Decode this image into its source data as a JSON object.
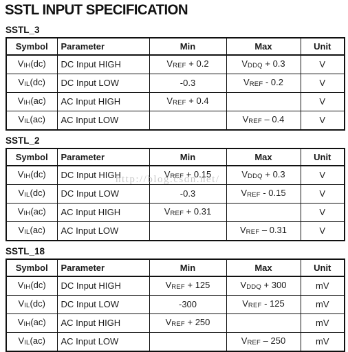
{
  "document": {
    "title": "SSTL INPUT SPECIFICATION",
    "watermark": "http://blog.csdn.net/"
  },
  "columns": {
    "symbol": "Symbol",
    "parameter": "Parameter",
    "min": "Min",
    "max": "Max",
    "unit": "Unit"
  },
  "sections": [
    {
      "label": "SSTL_3",
      "rows": [
        {
          "symbol_prefix": "V",
          "symbol_sub": "IH",
          "symbol_suffix": "(dc)",
          "parameter": "DC Input HIGH",
          "min_prefix": "V",
          "min_sub": "REF",
          "min_suffix": " + 0.2",
          "max_prefix": "V",
          "max_sub": "DDQ",
          "max_suffix": " + 0.3",
          "unit": "V"
        },
        {
          "symbol_prefix": "V",
          "symbol_sub": "IL",
          "symbol_suffix": "(dc)",
          "parameter": "DC Input LOW",
          "min_prefix": "-0.3",
          "min_sub": "",
          "min_suffix": "",
          "max_prefix": "V",
          "max_sub": "REF",
          "max_suffix": " - 0.2",
          "unit": "V"
        },
        {
          "symbol_prefix": "V",
          "symbol_sub": "IH",
          "symbol_suffix": "(ac)",
          "parameter": "AC Input HIGH",
          "min_prefix": "V",
          "min_sub": "REF",
          "min_suffix": " + 0.4",
          "max_prefix": "",
          "max_sub": "",
          "max_suffix": "",
          "unit": "V"
        },
        {
          "symbol_prefix": "V",
          "symbol_sub": "IL",
          "symbol_suffix": "(ac)",
          "parameter": "AC Input LOW",
          "min_prefix": "",
          "min_sub": "",
          "min_suffix": "",
          "max_prefix": "V",
          "max_sub": "REF",
          "max_suffix": " – 0.4",
          "unit": "V"
        }
      ]
    },
    {
      "label": "SSTL_2",
      "rows": [
        {
          "symbol_prefix": "V",
          "symbol_sub": "IH",
          "symbol_suffix": "(dc)",
          "parameter": "DC Input HIGH",
          "min_prefix": "V",
          "min_sub": "REF",
          "min_suffix": " + 0.15",
          "max_prefix": "V",
          "max_sub": "DDQ",
          "max_suffix": " + 0.3",
          "unit": "V"
        },
        {
          "symbol_prefix": "V",
          "symbol_sub": "IL",
          "symbol_suffix": "(dc)",
          "parameter": "DC Input LOW",
          "min_prefix": "-0.3",
          "min_sub": "",
          "min_suffix": "",
          "max_prefix": "V",
          "max_sub": "REF",
          "max_suffix": " - 0.15",
          "unit": "V"
        },
        {
          "symbol_prefix": "V",
          "symbol_sub": "IH",
          "symbol_suffix": "(ac)",
          "parameter": "AC Input HIGH",
          "min_prefix": "V",
          "min_sub": "REF",
          "min_suffix": " + 0.31",
          "max_prefix": "",
          "max_sub": "",
          "max_suffix": "",
          "unit": "V"
        },
        {
          "symbol_prefix": "V",
          "symbol_sub": "IL",
          "symbol_suffix": "(ac)",
          "parameter": "AC Input LOW",
          "min_prefix": "",
          "min_sub": "",
          "min_suffix": "",
          "max_prefix": "V",
          "max_sub": "REF",
          "max_suffix": " – 0.31",
          "unit": "V"
        }
      ]
    },
    {
      "label": "SSTL_18",
      "rows": [
        {
          "symbol_prefix": "V",
          "symbol_sub": "IH",
          "symbol_suffix": "(dc)",
          "parameter": "DC Input HIGH",
          "min_prefix": "V",
          "min_sub": "REF",
          "min_suffix": " + 125",
          "max_prefix": "V",
          "max_sub": "DDQ",
          "max_suffix": " + 300",
          "unit": "mV"
        },
        {
          "symbol_prefix": "V",
          "symbol_sub": "IL",
          "symbol_suffix": "(dc)",
          "parameter": "DC Input LOW",
          "min_prefix": "-300",
          "min_sub": "",
          "min_suffix": "",
          "max_prefix": "V",
          "max_sub": "REF",
          "max_suffix": " - 125",
          "unit": "mV"
        },
        {
          "symbol_prefix": "V",
          "symbol_sub": "IH",
          "symbol_suffix": "(ac)",
          "parameter": "AC Input HIGH",
          "min_prefix": "V",
          "min_sub": "REF",
          "min_suffix": " + 250",
          "max_prefix": "",
          "max_sub": "",
          "max_suffix": "",
          "unit": "mV"
        },
        {
          "symbol_prefix": "V",
          "symbol_sub": "IL",
          "symbol_suffix": "(ac)",
          "parameter": "AC Input LOW",
          "min_prefix": "",
          "min_sub": "",
          "min_suffix": "",
          "max_prefix": "V",
          "max_sub": "REF",
          "max_suffix": " – 250",
          "unit": "mV"
        }
      ]
    }
  ]
}
